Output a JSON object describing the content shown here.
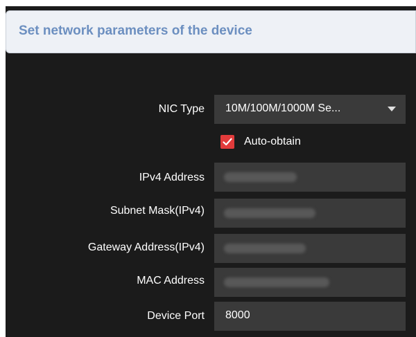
{
  "header": {
    "title": "Set network parameters of the device"
  },
  "form": {
    "nic_type": {
      "label": "NIC Type",
      "value": "10M/100M/1000M Se..."
    },
    "auto_obtain": {
      "label": "Auto-obtain",
      "checked": true
    },
    "ipv4_address": {
      "label": "IPv4 Address"
    },
    "subnet_mask": {
      "label": "Subnet Mask(IPv4)"
    },
    "gateway_address": {
      "label": "Gateway Address(IPv4)"
    },
    "mac_address": {
      "label": "MAC Address"
    },
    "device_port": {
      "label": "Device Port",
      "value": "8000"
    }
  },
  "colors": {
    "accent_checkbox": "#e23b3b",
    "header_title": "#6c8fc0",
    "panel_bg": "#1b1b1b",
    "field_bg": "#3a3a3a"
  },
  "icons": {
    "dropdown": "chevron-down-icon",
    "checkbox": "checkmark-icon"
  }
}
